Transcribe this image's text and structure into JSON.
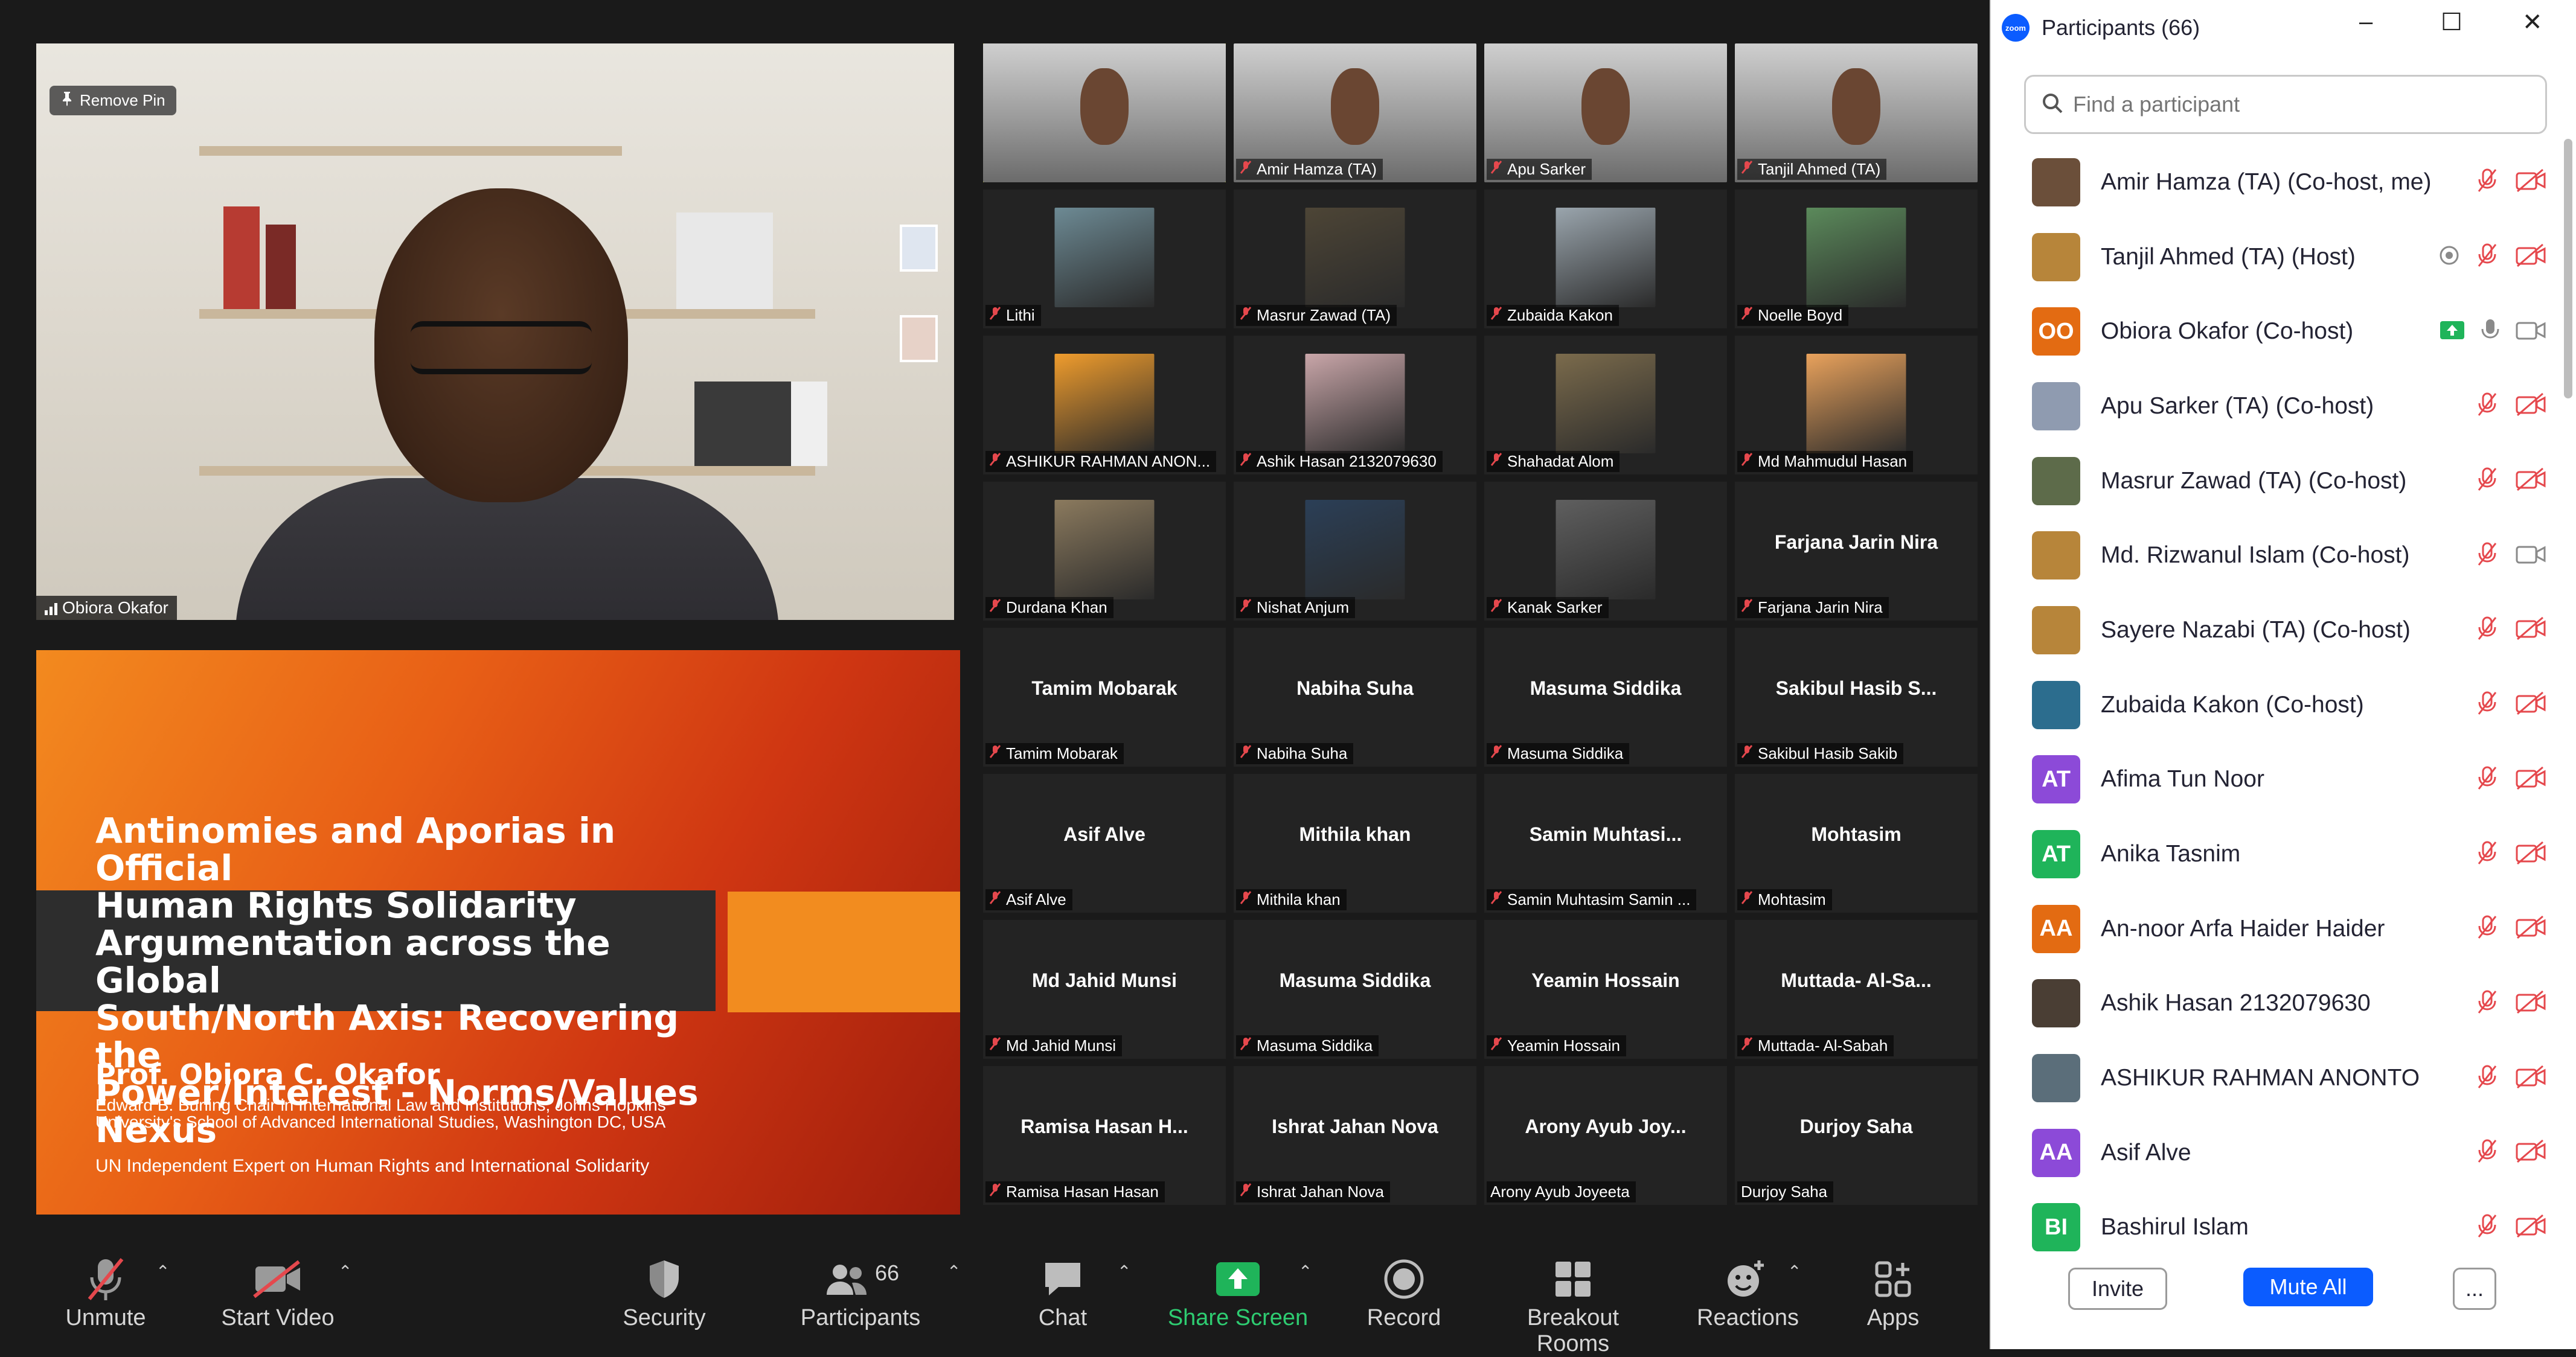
{
  "speaker": {
    "pin_label": "Remove Pin",
    "name": "Obiora Okafor"
  },
  "slide": {
    "title_lines": [
      "Antinomies and Aporias in Official",
      "Human Rights Solidarity",
      "Argumentation across the Global",
      "South/North Axis: Recovering the",
      "Power/Interest - Norms/Values Nexus"
    ],
    "author": "Prof. Obiora C. Okafor",
    "affiliation": "Edward B. Burling Chair in International Law and Institutions, Johns Hopkins University's School of Advanced International Studies, Washington DC, USA",
    "role": "UN Independent Expert on Human Rights and International Solidarity"
  },
  "gallery": [
    {
      "label": "",
      "type": "video",
      "muted": false
    },
    {
      "label": "Amir Hamza (TA)",
      "type": "video",
      "muted": true
    },
    {
      "label": "Apu Sarker",
      "type": "video",
      "muted": true
    },
    {
      "label": "Tanjil Ahmed (TA)",
      "type": "video",
      "muted": true
    },
    {
      "label": "Lithi",
      "type": "photo",
      "muted": true
    },
    {
      "label": "Masrur Zawad (TA)",
      "type": "photo",
      "muted": true
    },
    {
      "label": "Zubaida Kakon",
      "type": "photo",
      "muted": true
    },
    {
      "label": "Noelle Boyd",
      "type": "photo",
      "muted": true
    },
    {
      "label": "ASHIKUR RAHMAN ANON...",
      "type": "photo",
      "muted": true
    },
    {
      "label": "Ashik Hasan 2132079630",
      "type": "photo",
      "muted": true
    },
    {
      "label": "Shahadat Alom",
      "type": "photo",
      "muted": true
    },
    {
      "label": "Md Mahmudul Hasan",
      "type": "photo",
      "muted": true
    },
    {
      "label": "Durdana Khan",
      "type": "photo",
      "muted": true
    },
    {
      "label": "Nishat Anjum",
      "type": "photo",
      "muted": true
    },
    {
      "label": "Kanak Sarker",
      "type": "photo",
      "muted": true
    },
    {
      "label": "Farjana Jarin Nira",
      "big": "Farjana Jarin Nira",
      "type": "name",
      "muted": true
    },
    {
      "label": "Tamim Mobarak",
      "big": "Tamim Mobarak",
      "type": "name",
      "muted": true
    },
    {
      "label": "Nabiha Suha",
      "big": "Nabiha Suha",
      "type": "name",
      "muted": true
    },
    {
      "label": "Masuma Siddika",
      "big": "Masuma Siddika",
      "type": "name",
      "muted": true
    },
    {
      "label": "Sakibul Hasib Sakib",
      "big": "Sakibul Hasib S...",
      "type": "name",
      "muted": true
    },
    {
      "label": "Asif Alve",
      "big": "Asif Alve",
      "type": "name",
      "muted": true
    },
    {
      "label": "Mithila khan",
      "big": "Mithila khan",
      "type": "name",
      "muted": true
    },
    {
      "label": "Samin Muhtasim Samin ...",
      "big": "Samin Muhtasi...",
      "type": "name",
      "muted": true
    },
    {
      "label": "Mohtasim",
      "big": "Mohtasim",
      "type": "name",
      "muted": true
    },
    {
      "label": "Md Jahid Munsi",
      "big": "Md Jahid Munsi",
      "type": "name",
      "muted": true
    },
    {
      "label": "Masuma Siddika",
      "big": "Masuma Siddika",
      "type": "name",
      "muted": true
    },
    {
      "label": "Yeamin Hossain",
      "big": "Yeamin Hossain",
      "type": "name",
      "muted": true
    },
    {
      "label": "Muttada- Al-Sabah",
      "big": "Muttada- Al-Sa...",
      "type": "name",
      "muted": true
    },
    {
      "label": "Ramisa Hasan Hasan",
      "big": "Ramisa Hasan H...",
      "type": "name",
      "muted": true
    },
    {
      "label": "Ishrat Jahan Nova",
      "big": "Ishrat Jahan Nova",
      "type": "name",
      "muted": true
    },
    {
      "label": "Arony Ayub Joyeeta",
      "big": "Arony Ayub Joy...",
      "type": "name",
      "muted": false
    },
    {
      "label": "Durjoy Saha",
      "big": "Durjoy Saha",
      "type": "name",
      "muted": false
    }
  ],
  "toolbar": {
    "unmute": "Unmute",
    "start_video": "Start Video",
    "security": "Security",
    "participants": "Participants",
    "participants_count": "66",
    "chat": "Chat",
    "share_screen": "Share Screen",
    "record": "Record",
    "breakout_rooms": "Breakout Rooms",
    "reactions": "Reactions",
    "apps": "Apps"
  },
  "panel": {
    "title": "Participants (66)",
    "logo_text": "zoom",
    "search_placeholder": "Find a participant",
    "participants": [
      {
        "name": "Amir Hamza (TA) (Co-host, me)",
        "initials": "",
        "color": "#6b4f3a",
        "icons": [
          "mic-muted",
          "video-off"
        ]
      },
      {
        "name": "Tanjil Ahmed (TA) (Host)",
        "initials": "",
        "color": "#b7853a",
        "icons": [
          "recording",
          "mic-muted",
          "video-off"
        ]
      },
      {
        "name": "Obiora Okafor (Co-host)",
        "initials": "OO",
        "color": "#e36b12",
        "icons": [
          "share",
          "mic-on",
          "video-on"
        ]
      },
      {
        "name": "Apu Sarker (TA) (Co-host)",
        "initials": "",
        "color": "#8f9bb0",
        "icons": [
          "mic-muted",
          "video-off"
        ]
      },
      {
        "name": "Masrur Zawad (TA) (Co-host)",
        "initials": "",
        "color": "#5d6b4a",
        "icons": [
          "mic-muted",
          "video-off"
        ]
      },
      {
        "name": "Md. Rizwanul Islam (Co-host)",
        "initials": "",
        "color": "#b7853a",
        "icons": [
          "mic-muted",
          "video-on"
        ]
      },
      {
        "name": "Sayere Nazabi (TA) (Co-host)",
        "initials": "",
        "color": "#b7853a",
        "icons": [
          "mic-muted",
          "video-off"
        ]
      },
      {
        "name": "Zubaida Kakon (Co-host)",
        "initials": "",
        "color": "#2c6d8e",
        "icons": [
          "mic-muted",
          "video-off"
        ]
      },
      {
        "name": "Afima Tun Noor",
        "initials": "AT",
        "color": "#8c4ad8",
        "icons": [
          "mic-muted",
          "video-off"
        ]
      },
      {
        "name": "Anika Tasnim",
        "initials": "AT",
        "color": "#1fb45a",
        "icons": [
          "mic-muted",
          "video-off"
        ]
      },
      {
        "name": "An-noor Arfa Haider Haider",
        "initials": "AA",
        "color": "#e36b12",
        "icons": [
          "mic-muted",
          "video-off"
        ]
      },
      {
        "name": "Ashik Hasan 2132079630",
        "initials": "",
        "color": "#4a3e34",
        "icons": [
          "mic-muted",
          "video-off"
        ]
      },
      {
        "name": "ASHIKUR RAHMAN ANONTO",
        "initials": "",
        "color": "#5b6e7a",
        "icons": [
          "mic-muted",
          "video-off"
        ]
      },
      {
        "name": "Asif Alve",
        "initials": "AA",
        "color": "#8c4ad8",
        "icons": [
          "mic-muted",
          "video-off"
        ]
      },
      {
        "name": "Bashirul Islam",
        "initials": "BI",
        "color": "#1fb45a",
        "icons": [
          "mic-muted",
          "video-off"
        ]
      }
    ],
    "invite": "Invite",
    "mute_all": "Mute All",
    "more": "..."
  },
  "colors": {
    "accent": "#0b5cff",
    "muted_red": "#e5484d",
    "share_green": "#2ecc71",
    "active_speaker": "#cfd54a"
  }
}
